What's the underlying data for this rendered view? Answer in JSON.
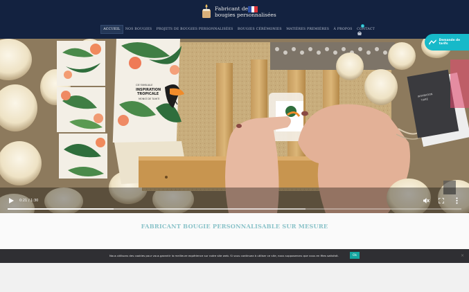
{
  "brand": {
    "line1": "Fabricant de",
    "line2": "bougies personnalisées"
  },
  "nav": {
    "items": [
      {
        "label": "ACCUEIL",
        "active": true
      },
      {
        "label": "NOS BOUGIES",
        "active": false
      },
      {
        "label": "PROJETS DE BOUGIES PERSONNALISÉES",
        "active": false
      },
      {
        "label": "BOUGIES CÉRÉMONIES",
        "active": false
      },
      {
        "label": "MATIÈRES PREMIÈRES",
        "active": false
      },
      {
        "label": "À PROPOS",
        "active": false
      },
      {
        "label": "CONTACT",
        "active": false
      }
    ],
    "cart_count": "0"
  },
  "quote_button": {
    "label": "Demande de tarifs"
  },
  "video": {
    "time": "0:21 / 1:30",
    "played_fraction": 0.233,
    "buffered_fraction": 0.656,
    "box_text": {
      "line1": "CIE FAMILIALE",
      "line2": "INSPIRATION",
      "line3": "TROPICALE",
      "line4": "MONOÏ DE TAHITI"
    },
    "right_box_line1": "INSPIRATION",
    "right_box_line2": "TIARÉ"
  },
  "section": {
    "title": "FABRICANT BOUGIE PERSONNALISABLE SUR MESURE"
  },
  "cookie": {
    "text": "Nous utilisons des cookies pour vous garantir la meilleure expérience sur notre site web. Si vous continuez à utiliser ce site, nous supposerons que vous en êtes satisfait.",
    "ok": "Ok",
    "close": "×"
  },
  "colors": {
    "header_bg": "#132240",
    "accent": "#17b9c9",
    "title": "#8bc3c9",
    "cookie_bg": "#2f2f33",
    "ok_bg": "#15a6a0"
  },
  "icons": [
    "candle-logo-icon",
    "french-flag-icon",
    "cart-icon",
    "quote-icon",
    "play-icon",
    "mute-icon",
    "fullscreen-icon",
    "more-vert-icon"
  ]
}
